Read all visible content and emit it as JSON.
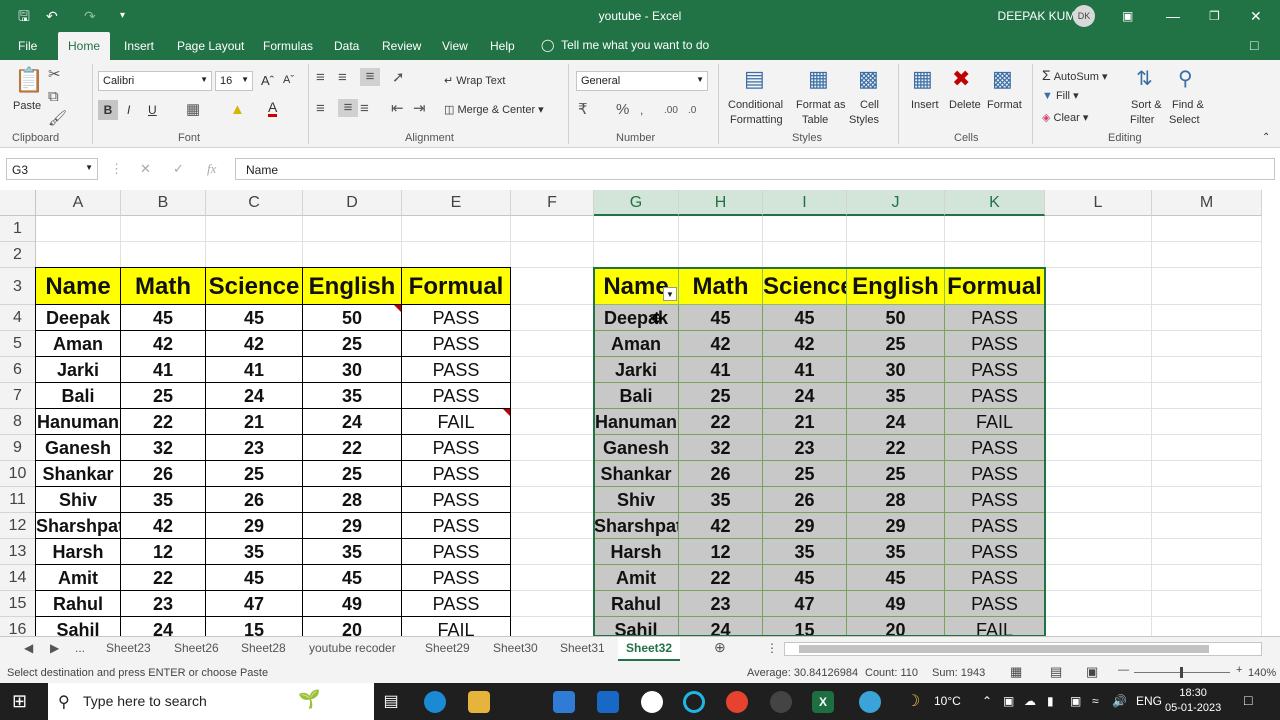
{
  "titlebar": {
    "title": "youtube  -  Excel",
    "user": "DEEPAK KUMAR",
    "avatar": "DK"
  },
  "menu": {
    "items": [
      "File",
      "Home",
      "Insert",
      "Page Layout",
      "Formulas",
      "Data",
      "Review",
      "View",
      "Help"
    ],
    "tell": "Tell me what you want to do"
  },
  "ribbon": {
    "clipboard": {
      "paste": "Paste",
      "label": "Clipboard"
    },
    "font": {
      "name": "Calibri",
      "size": "16",
      "bold": "B",
      "italic": "I",
      "underline": "U",
      "label": "Font"
    },
    "alignment": {
      "wrap": "Wrap Text",
      "merge": "Merge & Center",
      "label": "Alignment"
    },
    "number": {
      "format": "General",
      "label": "Number"
    },
    "styles": {
      "cond1": "Conditional",
      "cond2": "Formatting",
      "fmt1": "Format as",
      "fmt2": "Table",
      "cell1": "Cell",
      "cell2": "Styles",
      "label": "Styles"
    },
    "cells": {
      "insert": "Insert",
      "delete": "Delete",
      "format": "Format",
      "label": "Cells"
    },
    "editing": {
      "autosum": "AutoSum",
      "fill": "Fill",
      "clear": "Clear",
      "sort1": "Sort &",
      "sort2": "Filter",
      "find1": "Find &",
      "find2": "Select",
      "label": "Editing"
    }
  },
  "formula_bar": {
    "name_box": "G3",
    "value": "Name"
  },
  "columns": [
    "A",
    "B",
    "C",
    "D",
    "E",
    "F",
    "G",
    "H",
    "I",
    "J",
    "K",
    "L",
    "M"
  ],
  "rows": [
    "1",
    "2",
    "3",
    "4",
    "5",
    "6",
    "7",
    "8",
    "9",
    "10",
    "11",
    "12",
    "13",
    "14",
    "15",
    "16"
  ],
  "table": {
    "headers": [
      "Name",
      "Math",
      "Science",
      "English",
      "Formual"
    ],
    "rows": [
      [
        "Deepak",
        "45",
        "45",
        "50",
        "PASS"
      ],
      [
        "Aman",
        "42",
        "42",
        "25",
        "PASS"
      ],
      [
        "Jarki",
        "41",
        "41",
        "30",
        "PASS"
      ],
      [
        "Bali",
        "25",
        "24",
        "35",
        "PASS"
      ],
      [
        "Hanuman",
        "22",
        "21",
        "24",
        "FAIL"
      ],
      [
        "Ganesh",
        "32",
        "23",
        "22",
        "PASS"
      ],
      [
        "Shankar",
        "26",
        "25",
        "25",
        "PASS"
      ],
      [
        "Shiv",
        "35",
        "26",
        "28",
        "PASS"
      ],
      [
        "Sharshpati",
        "42",
        "29",
        "29",
        "PASS"
      ],
      [
        "Harsh",
        "12",
        "35",
        "35",
        "PASS"
      ],
      [
        "Amit",
        "22",
        "45",
        "45",
        "PASS"
      ],
      [
        "Rahul",
        "23",
        "47",
        "49",
        "PASS"
      ],
      [
        "Sahil",
        "24",
        "15",
        "20",
        "FAIL"
      ]
    ]
  },
  "sheets": {
    "tabs": [
      "...",
      "Sheet23",
      "Sheet26",
      "Sheet28",
      "youtube recoder",
      "Sheet29",
      "Sheet30",
      "Sheet31",
      "Sheet32"
    ],
    "active": "Sheet32"
  },
  "status": {
    "message": "Select destination and press ENTER or choose Paste",
    "average": "Average: 30.84126984",
    "count": "Count: 110",
    "sum": "Sum: 1943",
    "zoom": "140%"
  },
  "taskbar": {
    "search": "Type here to search",
    "weather": "10°C",
    "lang": "ENG",
    "time": "18:30",
    "date": "05-01-2023"
  }
}
